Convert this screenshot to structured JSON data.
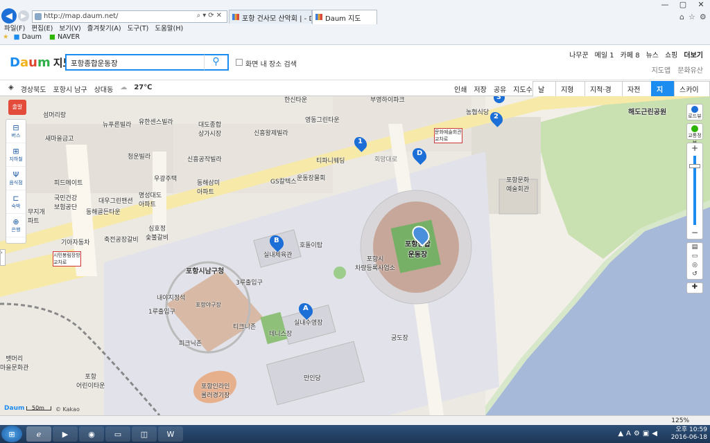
{
  "browser": {
    "url": "http://map.daum.net/",
    "tabs": [
      {
        "label": "포항 건사모 산악회 | - Daum ..."
      },
      {
        "label": "Daum 지도"
      }
    ],
    "menu": [
      "파일(F)",
      "편집(E)",
      "보기(V)",
      "즐겨찾기(A)",
      "도구(T)",
      "도움말(H)"
    ],
    "favorites": [
      "Daum",
      "NAVER"
    ],
    "win_controls": [
      "—",
      "▢",
      "✕"
    ]
  },
  "header": {
    "logo": {
      "d": "D",
      "a": "a",
      "u": "u",
      "m": "m",
      "title": "지도"
    },
    "search_value": "포항종합운동장",
    "search_icon": "search-icon",
    "checkbox_label": "화면 내 장소 검색",
    "topnav": [
      "나무꾼",
      "메일 1",
      "카페 8",
      "뉴스",
      "쇼핑",
      "더보기"
    ],
    "subnav": [
      "지도앱",
      "문화유산"
    ]
  },
  "toolbar": {
    "crumbs": [
      "경상북도",
      "포항시 남구",
      "상대동"
    ],
    "weather": "27℃",
    "tools": [
      "인쇄",
      "저장",
      "공유",
      "지도수정"
    ],
    "map_types": [
      "날씨",
      "지형도",
      "지적·경계",
      "자전거",
      "지도",
      "스카이뷰"
    ],
    "active_map_type": "지도"
  },
  "left_tools": [
    "버스",
    "지하철",
    "음식점",
    "숙박",
    "은행"
  ],
  "left_badge": "출발",
  "right_tools": [
    "로드뷰",
    "교통정보"
  ],
  "map_labels": {
    "sports_complex": "포항종합\n운동장",
    "namgu_office": "포항시남구청",
    "indoor_gym": "실내체육관",
    "indoor_pool": "실내수영장",
    "park": "해도근린공원",
    "baseball": "포항야구장",
    "culture_center": "포항문화\n예술회관",
    "hotel": "포항시\n차량등록사업소",
    "list": [
      "섬머리랑",
      "뉴푸른빌라",
      "유한센스빌라",
      "새마을금고",
      "청운빌라",
      "우광주택",
      "동해삼미\n아파트",
      "명성대도\n아파트",
      "대우그린맨션",
      "동해골든타운",
      "국민건강\n보험공단",
      "무지개\n파트",
      "기아자동차",
      "축전공장갈비",
      "피드메이트",
      "신흥공작빌라",
      "영동그린타운",
      "신흥왕제빌라",
      "티파니웨딩",
      "GS칼텍스",
      "운동장물회",
      "대도종합\n상가시장",
      "한신타운",
      "부영하이파크",
      "농협식당",
      "문화예술회관\n교차로",
      "호돌이탑",
      "3루출입구",
      "1루출입구",
      "내야지정석",
      "티크니존",
      "피크닉존",
      "테니스장",
      "궁도장",
      "만인당",
      "포항인라인\n롤러경기장",
      "포항\n어린이타운",
      "뱃머리\n마을문화관",
      "시민봉림장방\n교차로",
      "심호정\n숯불갈비",
      "회망대로"
    ]
  },
  "markers": [
    "1",
    "2",
    "3",
    "A",
    "B",
    "D"
  ],
  "scale": "50m",
  "copyright": "© Kakao",
  "zoom": "125%",
  "taskbar": {
    "time": "오후 10:59",
    "date": "2016-06-18"
  }
}
